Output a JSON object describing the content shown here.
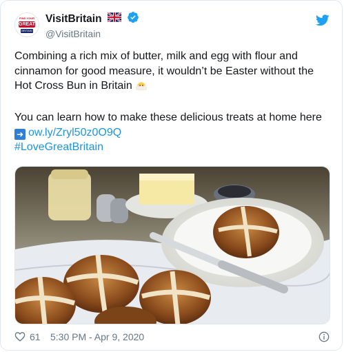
{
  "tweet": {
    "display_name": "VisitBritain",
    "handle": "@VisitBritain",
    "avatar_text": {
      "top": "FIND YOUR",
      "mid": "GREAT",
      "bottom": "BRITAIN"
    },
    "text_line1": "Combining a rich mix of butter, milk and egg with flour and cinnamon for good measure, it wouldn’t be Easter without the Hot Cross Bun in Britain",
    "text_line2": "You can learn how to make these delicious treats at home here",
    "link": "ow.ly/Zryl50z0O9Q",
    "hashtag": "#LoveGreatBritain",
    "likes": "61",
    "timestamp": "5:30 PM - Apr 9, 2020"
  },
  "colors": {
    "link": "#1b95e0",
    "twitter_blue": "#1da1f2",
    "secondary": "#657786",
    "border": "#e1e8ed"
  },
  "icons": [
    "uk-flag-icon",
    "verified-badge-icon",
    "twitter-bird-icon",
    "chick-emoji-icon",
    "right-arrow-emoji-icon",
    "heart-icon",
    "info-icon"
  ]
}
